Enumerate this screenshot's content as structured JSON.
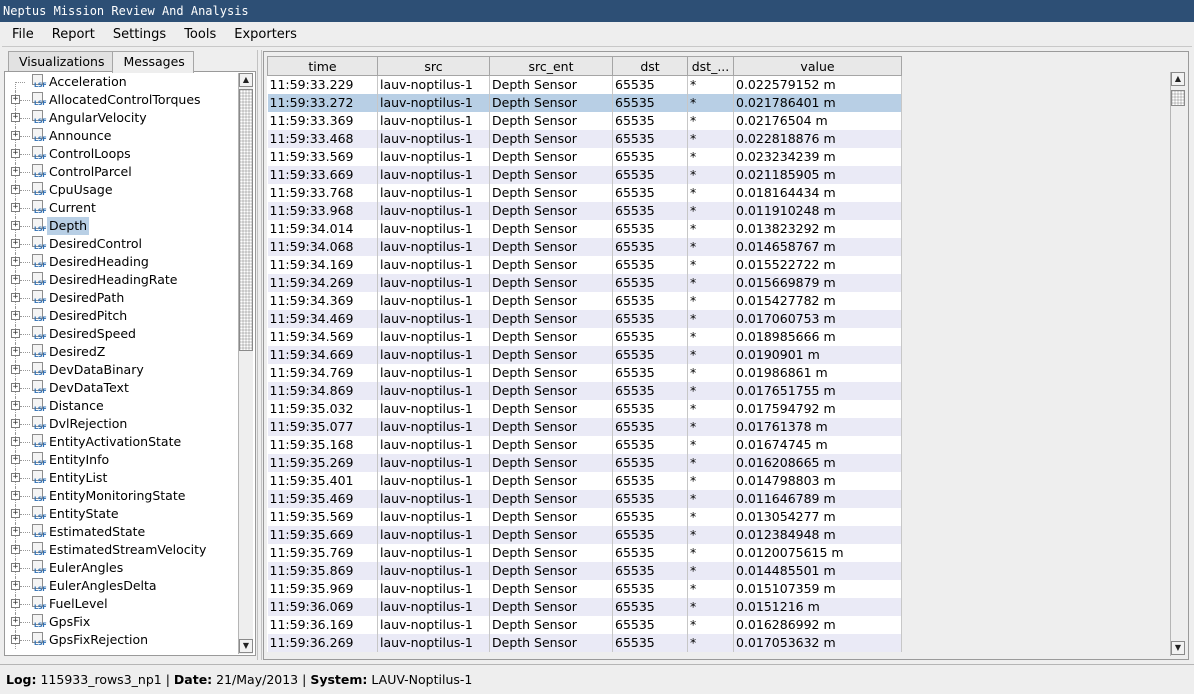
{
  "window": {
    "title": "Neptus Mission Review And Analysis"
  },
  "menu": [
    "File",
    "Report",
    "Settings",
    "Tools",
    "Exporters"
  ],
  "tabs": [
    {
      "label": "Visualizations",
      "active": false
    },
    {
      "label": "Messages",
      "active": true
    }
  ],
  "tree": {
    "icon_text": "LSF",
    "selected": "Depth",
    "items": [
      {
        "label": "Acceleration",
        "expandable": false
      },
      {
        "label": "AllocatedControlTorques",
        "expandable": true
      },
      {
        "label": "AngularVelocity",
        "expandable": true
      },
      {
        "label": "Announce",
        "expandable": true
      },
      {
        "label": "ControlLoops",
        "expandable": true
      },
      {
        "label": "ControlParcel",
        "expandable": true
      },
      {
        "label": "CpuUsage",
        "expandable": true
      },
      {
        "label": "Current",
        "expandable": true
      },
      {
        "label": "Depth",
        "expandable": true
      },
      {
        "label": "DesiredControl",
        "expandable": true
      },
      {
        "label": "DesiredHeading",
        "expandable": true
      },
      {
        "label": "DesiredHeadingRate",
        "expandable": true
      },
      {
        "label": "DesiredPath",
        "expandable": true
      },
      {
        "label": "DesiredPitch",
        "expandable": true
      },
      {
        "label": "DesiredSpeed",
        "expandable": true
      },
      {
        "label": "DesiredZ",
        "expandable": true
      },
      {
        "label": "DevDataBinary",
        "expandable": true
      },
      {
        "label": "DevDataText",
        "expandable": true
      },
      {
        "label": "Distance",
        "expandable": true
      },
      {
        "label": "DvlRejection",
        "expandable": true
      },
      {
        "label": "EntityActivationState",
        "expandable": true
      },
      {
        "label": "EntityInfo",
        "expandable": true
      },
      {
        "label": "EntityList",
        "expandable": true
      },
      {
        "label": "EntityMonitoringState",
        "expandable": true
      },
      {
        "label": "EntityState",
        "expandable": true
      },
      {
        "label": "EstimatedState",
        "expandable": true
      },
      {
        "label": "EstimatedStreamVelocity",
        "expandable": true
      },
      {
        "label": "EulerAngles",
        "expandable": true
      },
      {
        "label": "EulerAnglesDelta",
        "expandable": true
      },
      {
        "label": "FuelLevel",
        "expandable": true
      },
      {
        "label": "GpsFix",
        "expandable": true
      },
      {
        "label": "GpsFixRejection",
        "expandable": true
      }
    ]
  },
  "table": {
    "columns": [
      "time",
      "src",
      "src_ent",
      "dst",
      "dst_...",
      "value"
    ],
    "selected_row": 1,
    "rows": [
      [
        "11:59:33.229",
        "lauv-noptilus-1",
        "Depth Sensor",
        "65535",
        "*",
        "0.022579152 m"
      ],
      [
        "11:59:33.272",
        "lauv-noptilus-1",
        "Depth Sensor",
        "65535",
        "*",
        "0.021786401 m"
      ],
      [
        "11:59:33.369",
        "lauv-noptilus-1",
        "Depth Sensor",
        "65535",
        "*",
        "0.02176504 m"
      ],
      [
        "11:59:33.468",
        "lauv-noptilus-1",
        "Depth Sensor",
        "65535",
        "*",
        "0.022818876 m"
      ],
      [
        "11:59:33.569",
        "lauv-noptilus-1",
        "Depth Sensor",
        "65535",
        "*",
        "0.023234239 m"
      ],
      [
        "11:59:33.669",
        "lauv-noptilus-1",
        "Depth Sensor",
        "65535",
        "*",
        "0.021185905 m"
      ],
      [
        "11:59:33.768",
        "lauv-noptilus-1",
        "Depth Sensor",
        "65535",
        "*",
        "0.018164434 m"
      ],
      [
        "11:59:33.968",
        "lauv-noptilus-1",
        "Depth Sensor",
        "65535",
        "*",
        "0.011910248 m"
      ],
      [
        "11:59:34.014",
        "lauv-noptilus-1",
        "Depth Sensor",
        "65535",
        "*",
        "0.013823292 m"
      ],
      [
        "11:59:34.068",
        "lauv-noptilus-1",
        "Depth Sensor",
        "65535",
        "*",
        "0.014658767 m"
      ],
      [
        "11:59:34.169",
        "lauv-noptilus-1",
        "Depth Sensor",
        "65535",
        "*",
        "0.015522722 m"
      ],
      [
        "11:59:34.269",
        "lauv-noptilus-1",
        "Depth Sensor",
        "65535",
        "*",
        "0.015669879 m"
      ],
      [
        "11:59:34.369",
        "lauv-noptilus-1",
        "Depth Sensor",
        "65535",
        "*",
        "0.015427782 m"
      ],
      [
        "11:59:34.469",
        "lauv-noptilus-1",
        "Depth Sensor",
        "65535",
        "*",
        "0.017060753 m"
      ],
      [
        "11:59:34.569",
        "lauv-noptilus-1",
        "Depth Sensor",
        "65535",
        "*",
        "0.018985666 m"
      ],
      [
        "11:59:34.669",
        "lauv-noptilus-1",
        "Depth Sensor",
        "65535",
        "*",
        "0.0190901 m"
      ],
      [
        "11:59:34.769",
        "lauv-noptilus-1",
        "Depth Sensor",
        "65535",
        "*",
        "0.01986861 m"
      ],
      [
        "11:59:34.869",
        "lauv-noptilus-1",
        "Depth Sensor",
        "65535",
        "*",
        "0.017651755 m"
      ],
      [
        "11:59:35.032",
        "lauv-noptilus-1",
        "Depth Sensor",
        "65535",
        "*",
        "0.017594792 m"
      ],
      [
        "11:59:35.077",
        "lauv-noptilus-1",
        "Depth Sensor",
        "65535",
        "*",
        "0.01761378 m"
      ],
      [
        "11:59:35.168",
        "lauv-noptilus-1",
        "Depth Sensor",
        "65535",
        "*",
        "0.01674745 m"
      ],
      [
        "11:59:35.269",
        "lauv-noptilus-1",
        "Depth Sensor",
        "65535",
        "*",
        "0.016208665 m"
      ],
      [
        "11:59:35.401",
        "lauv-noptilus-1",
        "Depth Sensor",
        "65535",
        "*",
        "0.014798803 m"
      ],
      [
        "11:59:35.469",
        "lauv-noptilus-1",
        "Depth Sensor",
        "65535",
        "*",
        "0.011646789 m"
      ],
      [
        "11:59:35.569",
        "lauv-noptilus-1",
        "Depth Sensor",
        "65535",
        "*",
        "0.013054277 m"
      ],
      [
        "11:59:35.669",
        "lauv-noptilus-1",
        "Depth Sensor",
        "65535",
        "*",
        "0.012384948 m"
      ],
      [
        "11:59:35.769",
        "lauv-noptilus-1",
        "Depth Sensor",
        "65535",
        "*",
        "0.0120075615 m"
      ],
      [
        "11:59:35.869",
        "lauv-noptilus-1",
        "Depth Sensor",
        "65535",
        "*",
        "0.014485501 m"
      ],
      [
        "11:59:35.969",
        "lauv-noptilus-1",
        "Depth Sensor",
        "65535",
        "*",
        "0.015107359 m"
      ],
      [
        "11:59:36.069",
        "lauv-noptilus-1",
        "Depth Sensor",
        "65535",
        "*",
        "0.0151216 m"
      ],
      [
        "11:59:36.169",
        "lauv-noptilus-1",
        "Depth Sensor",
        "65535",
        "*",
        "0.016286992 m"
      ],
      [
        "11:59:36.269",
        "lauv-noptilus-1",
        "Depth Sensor",
        "65535",
        "*",
        "0.017053632 m"
      ]
    ]
  },
  "status": {
    "log_label": "Log:",
    "log_value": "115933_rows3_np1",
    "date_label": "Date:",
    "date_value": "21/May/2013",
    "system_label": "System:",
    "system_value": "LAUV-Noptilus-1",
    "separator": "|"
  },
  "colors": {
    "titlebar": "#2d4f75",
    "selection": "#b8cfe5",
    "alt_row": "#eaeaf6"
  }
}
